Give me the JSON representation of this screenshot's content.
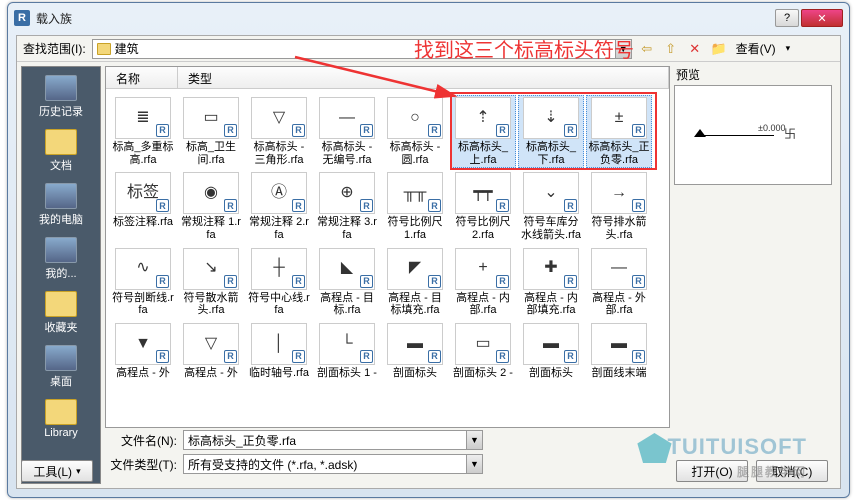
{
  "window": {
    "title": "载入族",
    "app_badge": "R"
  },
  "pathbar": {
    "label": "查找范围(I):",
    "folder": "建筑",
    "view_label": "查看(V)"
  },
  "sidebar": {
    "items": [
      {
        "label": "历史记录",
        "icon": "monitor"
      },
      {
        "label": "文档",
        "icon": "folder"
      },
      {
        "label": "我的电脑",
        "icon": "monitor"
      },
      {
        "label": "我的...",
        "icon": "monitor"
      },
      {
        "label": "收藏夹",
        "icon": "folder"
      },
      {
        "label": "桌面",
        "icon": "monitor"
      },
      {
        "label": "Library",
        "icon": "folder"
      }
    ]
  },
  "columns": {
    "name": "名称",
    "type": "类型"
  },
  "preview": {
    "label": "预览",
    "text": "±0.000"
  },
  "files": [
    {
      "name": "标高_多重标高.rfa",
      "g": "≣"
    },
    {
      "name": "标高_卫生间.rfa",
      "g": "▭"
    },
    {
      "name": "标高标头 - 三角形.rfa",
      "g": "▽"
    },
    {
      "name": "标高标头 - 无编号.rfa",
      "g": "—"
    },
    {
      "name": "标高标头 - 圆.rfa",
      "g": "○"
    },
    {
      "name": "标高标头_上.rfa",
      "g": "⇡",
      "sel": true
    },
    {
      "name": "标高标头_下.rfa",
      "g": "⇣",
      "sel": true
    },
    {
      "name": "标高标头_正负零.rfa",
      "g": "±",
      "sel": true
    },
    {
      "name": "标签注释.rfa",
      "g": "标签"
    },
    {
      "name": "常规注释 1.rfa",
      "g": "◉"
    },
    {
      "name": "常规注释 2.rfa",
      "g": "Ⓐ"
    },
    {
      "name": "常规注释 3.rfa",
      "g": "⊕"
    },
    {
      "name": "符号比例尺 1.rfa",
      "g": "╥╥"
    },
    {
      "name": "符号比例尺 2.rfa",
      "g": "┯┯"
    },
    {
      "name": "符号车库分水线箭头.rfa",
      "g": "⌄"
    },
    {
      "name": "符号排水箭头.rfa",
      "g": "→"
    },
    {
      "name": "符号剖断线.rfa",
      "g": "∿"
    },
    {
      "name": "符号散水箭头.rfa",
      "g": "↘"
    },
    {
      "name": "符号中心线.rfa",
      "g": "┼"
    },
    {
      "name": "高程点 - 目标.rfa",
      "g": "◣"
    },
    {
      "name": "高程点 - 目标填充.rfa",
      "g": "◤"
    },
    {
      "name": "高程点 - 内部.rfa",
      "g": "+"
    },
    {
      "name": "高程点 - 内部填充.rfa",
      "g": "✚"
    },
    {
      "name": "高程点 - 外部.rfa",
      "g": "—"
    },
    {
      "name": "高程点 - 外",
      "g": "▼"
    },
    {
      "name": "高程点 - 外",
      "g": "▽"
    },
    {
      "name": "临时轴号.rfa",
      "g": "│"
    },
    {
      "name": "剖面标头 1 -",
      "g": "└"
    },
    {
      "name": "剖面标头",
      "g": "▬"
    },
    {
      "name": "剖面标头 2 -",
      "g": "▭"
    },
    {
      "name": "剖面标头",
      "g": "▬"
    },
    {
      "name": "剖面线末端",
      "g": "▬"
    }
  ],
  "bottom": {
    "filename_label": "文件名(N):",
    "filename_value": "标高标头_正负零.rfa",
    "filetype_label": "文件类型(T):",
    "filetype_value": "所有受支持的文件 (*.rfa, *.adsk)",
    "tools": "工具(L)",
    "open": "打开(O)",
    "cancel": "取消(C)"
  },
  "annotation": "找到这三个标高标头符号",
  "watermark": {
    "brand": "TUITUISOFT",
    "sub": "腿腿教学网"
  }
}
